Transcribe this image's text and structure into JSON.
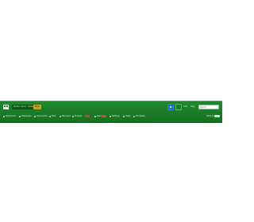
{
  "toolbar": {
    "tabs": [
      {
        "label": "Public Library"
      },
      {
        "label": "Index"
      },
      {
        "label": "Free"
      }
    ],
    "buttons": [
      {
        "label": "▶"
      },
      {
        "label": ""
      }
    ],
    "mini_text": [
      "Grid",
      "Help"
    ],
    "search": {
      "placeholder": "Search"
    }
  },
  "nav": {
    "items": [
      {
        "label": "Dashboard"
      },
      {
        "label": "Databases"
      },
      {
        "label": "Documents"
      },
      {
        "label": "Files"
      },
      {
        "label": "Members"
      },
      {
        "label": "Projects"
      },
      {
        "label": "Reports"
      },
      {
        "label": "Settings"
      },
      {
        "label": "Tasks"
      },
      {
        "label": "Templates"
      }
    ],
    "right_label": "Options"
  },
  "colors": {
    "bar": "#1a7a26",
    "active_tab": "#c8a21a",
    "accent_button": "#2a6fb4",
    "badge": "#d3412f"
  }
}
